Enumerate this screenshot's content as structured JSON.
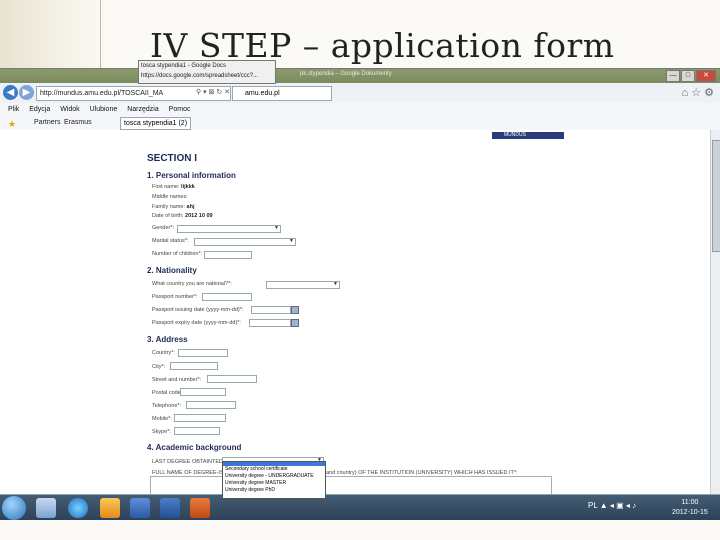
{
  "slide": {
    "title": "IV STEP – application form"
  },
  "browser": {
    "window_title": "pk.stypendia – Google Dokumenty",
    "url": "http://mundus.amu.edu.pl/TOSCAII_MA",
    "url_controls": "⚲ ▾ ⊠ ↻ ✕",
    "tab_label": "amu.edu.pl",
    "menu": [
      "Plik",
      "Edycja",
      "Widok",
      "Ulubione",
      "Narzędzia",
      "Pomoc"
    ],
    "favorites": [
      "Partners",
      "Erasmus",
      "tosca stypendia1 (2)"
    ],
    "tooltip_line1": "tosca stypendia1 - Google Docs",
    "tooltip_line2": "https://docs.google.com/spreadsheet/ccc?...",
    "window_buttons": {
      "minimize": "—",
      "maximize": "□",
      "close": "✕"
    }
  },
  "form": {
    "logo_text": "MUNDUS",
    "section_title": "SECTION I",
    "personal": {
      "heading": "1. Personal information",
      "first_name_label": "First name:",
      "first_name_value": "lijkkk",
      "middle_name_label": "Middle names:",
      "family_name_label": "Family name:",
      "family_name_value": "ahj",
      "dob_label": "Date of birth:",
      "dob_value": "2012 10 09",
      "gender_label": "Gender*:",
      "marital_label": "Marital status*:",
      "children_label": "Number of children*:"
    },
    "nationality": {
      "heading": "2. Nationality",
      "country_label": "What country you are national?*:",
      "passport_label": "Passport number*:",
      "issuing_label": "Passport issuing date (yyyy-mm-dd)*:",
      "expiry_label": "Passport expiry date (yyyy-mm-dd)*:"
    },
    "address": {
      "heading": "3. Address",
      "country_label": "Country*:",
      "city_label": "City*:",
      "street_label": "Street and number*:",
      "postal_label": "Postal code*:",
      "telephone_label": "Telephone*:",
      "mobile_label": "Mobile*:",
      "skype_label": "Skype*:"
    },
    "academic": {
      "heading": "4. Academic background",
      "last_degree_label": "LAST DEGREE OBTAINTED*:",
      "institution_label_a": "FULL NAME OF DEGREE-IS",
      "institution_label_b": "and country) OF THE INSTITUTION (UNIVERSITY) WHICH HAS ISSUED IT*:",
      "degree_options": [
        "",
        "Secondary school certificate",
        "University degree - UNDERGRADUATE",
        "University degree MASTER",
        "University degree PhD"
      ]
    }
  },
  "taskbar": {
    "tray_text": "PL ▲ ◂ ▣ ◂ ♪",
    "time": "11:00",
    "date": "2012-10-15"
  }
}
